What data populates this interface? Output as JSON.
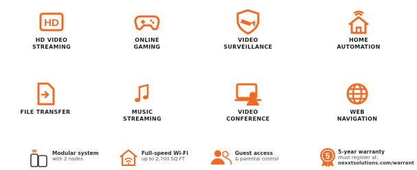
{
  "features": [
    {
      "icon": "hd-icon",
      "lines": [
        "HD VIDEO",
        "STREAMING"
      ]
    },
    {
      "icon": "gamepad-icon",
      "lines": [
        "ONLINE",
        "GAMING"
      ]
    },
    {
      "icon": "security-camera-icon",
      "lines": [
        "VIDEO",
        "SURVEILLANCE"
      ]
    },
    {
      "icon": "smart-home-icon",
      "lines": [
        "HOME",
        "AUTOMATION"
      ]
    },
    {
      "icon": "file-transfer-icon",
      "lines": [
        "FILE TRANSFER"
      ]
    },
    {
      "icon": "music-note-icon",
      "lines": [
        "MUSIC",
        "STREAMING"
      ]
    },
    {
      "icon": "video-conference-icon",
      "lines": [
        "VIDEO",
        "CONFERENCE"
      ]
    },
    {
      "icon": "globe-icon",
      "lines": [
        "WEB",
        "NAVIGATION"
      ]
    }
  ],
  "hd_icon_text": "HD",
  "bottom": [
    {
      "icon": "router-icon",
      "title": "Modular system",
      "sub": "with 2 nodes"
    },
    {
      "icon": "home-wifi-icon",
      "title": "Full-speed Wi-Fi",
      "sub": "up to 2,700 SQ FT"
    },
    {
      "icon": "users-icon",
      "title": "Guest access",
      "sub": "& parental control"
    },
    {
      "icon": "warranty-badge-icon",
      "title": "5-year warranty",
      "sub": "must register at:",
      "sub2": "nexxtsolutions.com/warrant"
    }
  ],
  "warranty_badge_number": "5",
  "colors": {
    "accent": "#f26a21",
    "text": "#1f1f1f",
    "muted": "#555555"
  }
}
